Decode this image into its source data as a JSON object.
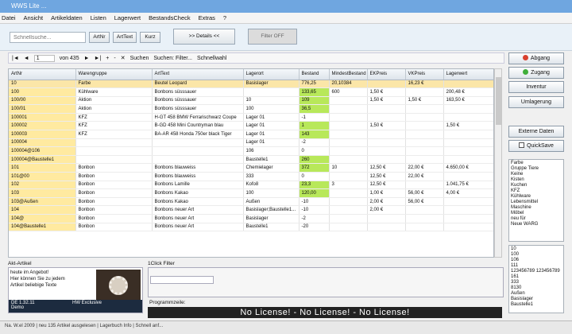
{
  "window": {
    "title": "WWS Lite ..."
  },
  "menu": [
    "Datei",
    "Ansicht",
    "Artikeldaten",
    "Listen",
    "Lagerwert",
    "BestandsCheck",
    "Extras",
    "?"
  ],
  "toolbar": {
    "search_placeholder": "Schnellsuche...",
    "btn_artnr": "ArtNr",
    "btn_arttext": "ArtText",
    "btn_kurz": "Kurz",
    "btn_details": ">> Details <<",
    "btn_filter": "Filter OFF"
  },
  "navbar": {
    "first": "|◄",
    "prev": "◄",
    "position": "1",
    "of_label": "von 435",
    "next": "►",
    "last": "►|",
    "add": "+",
    "delete": "-",
    "cancel": "✕",
    "search": "Suchen",
    "filter": "Suchen: Filter...",
    "quick": "Schnellwahl"
  },
  "grid": {
    "columns": [
      "ArtNr",
      "Warengruppe",
      "ArtText",
      "Lagerort",
      "Bestand",
      "MindestBestand",
      "EKPreis",
      "VKPreis",
      "Lagerwert"
    ],
    "rows": [
      [
        "10",
        "Farbe",
        "Beutel Leopard",
        "Basislager",
        "776,25",
        "20,10384",
        "",
        "16,23 €",
        ""
      ],
      [
        "100",
        "Kühlware",
        "Bonbons süsssauer",
        "",
        "133,65",
        "600",
        "1,50 €",
        "",
        "200,48 €"
      ],
      [
        "100/00",
        "Aktion",
        "Bonbons süsssauer",
        "10",
        "109",
        "",
        "1,50 €",
        "1,50 €",
        "163,50 €"
      ],
      [
        "100/01",
        "Aktion",
        "Bonbons süsssauer",
        "100",
        "36,5",
        "",
        "",
        "",
        ""
      ],
      [
        "100001",
        "KFZ",
        "H-GT 458 BMW Ferrarischwarz Coupe",
        "Lager 01",
        "-1",
        "",
        "",
        "",
        ""
      ],
      [
        "100002",
        "KFZ",
        "B-GD 458 Mini Countryman blau",
        "Lager 01",
        "1",
        "",
        "1,50 €",
        "",
        "1,50 €"
      ],
      [
        "100003",
        "KFZ",
        "BA-AR 458 Honda 750er black Tiger",
        "Lager 01",
        "143",
        "",
        "",
        "",
        ""
      ],
      [
        "100004",
        "",
        "",
        "Lager 01",
        "-2",
        "",
        "",
        "",
        ""
      ],
      [
        "100004@106",
        "",
        "",
        "106",
        "0",
        "",
        "",
        "",
        ""
      ],
      [
        "100004@Baustelle1",
        "",
        "",
        "Baustelle1",
        "260",
        "",
        "",
        "",
        ""
      ],
      [
        "101",
        "Bonbon",
        "Bonbons blauweiss",
        "Chemielager",
        "372",
        "10",
        "12,50 €",
        "22,00 €",
        "4.650,00 €"
      ],
      [
        "101@00",
        "Bonbon",
        "Bonbons blauweiss",
        "333",
        "0",
        "",
        "12,50 €",
        "22,00 €",
        ""
      ],
      [
        "102",
        "Bonbon",
        "Bonbons Lamille",
        "Kofo8",
        "23,3",
        "3",
        "12,50 €",
        "",
        "1.041,75 €"
      ],
      [
        "103",
        "Bonbon",
        "Bonbons Kakao",
        "100",
        "120,00",
        "",
        "1,00 €",
        "56,00 €",
        "4,00 €"
      ],
      [
        "103@Außen",
        "Bonbon",
        "Bonbons Kakao",
        "Außen",
        "-10",
        "",
        "2,00 €",
        "56,00 €",
        ""
      ],
      [
        "104",
        "Bonbon",
        "Bonbons neuer Art",
        "Basislager;Baustelle1...",
        "-10",
        "",
        "2,00 €",
        "",
        ""
      ],
      [
        "104@",
        "Bonbon",
        "Bonbons neuer Art",
        "Basislager",
        "-2",
        "",
        "",
        "",
        ""
      ],
      [
        "104@Baustelle1",
        "Bonbon",
        "Bonbons neuer Art",
        "Baustelle1",
        "-20",
        "",
        "",
        "",
        ""
      ]
    ]
  },
  "right_panel": {
    "btn_abgang": "Abgang",
    "btn_zugang": "Zugang",
    "btn_inventur": "Inventur",
    "btn_umlagerung": "Umlagerung",
    "btn_externe": "Externe Daten",
    "btn_quicksave": "QuickSave",
    "groups": [
      "Farbe",
      "Gruppe Tiere",
      "Keine",
      "Kisten",
      "Kuchen",
      "KFZ",
      "Kühlware",
      "Lebensmittel",
      "Maschine",
      "Möbel",
      "neu für",
      "Neue WARG"
    ],
    "lagerorte": [
      "10",
      "100",
      "106",
      "111",
      "123456789 123456789",
      "161",
      "333",
      "8130",
      "Außen",
      "Basislager",
      "Baustelle1"
    ]
  },
  "bottom": {
    "artikel_title": "Akt-Artikel",
    "artikel_text": [
      "heute im Angebot!",
      "Hier können Sie zu jedem",
      "Artikel beliebige Texte"
    ],
    "artikel_footer_left": "DE 1.32.11",
    "artikel_footer_right": "HW Exclusive",
    "artikel_footer_line2": "Demo",
    "filter_title": "1Click Filter",
    "prog_label": "Programmzeile:",
    "no_license": "No License! - No License! - No License!"
  },
  "status": {
    "text": "Na. W.el 2009 | neu 135 Artikel ausgelesen | Lagerbuch Info | Schnell anf..."
  },
  "colors": {
    "accent": "#6fa6e0",
    "highlight_green": "#b8e85a",
    "highlight_yellow": "#ffeaa0"
  }
}
